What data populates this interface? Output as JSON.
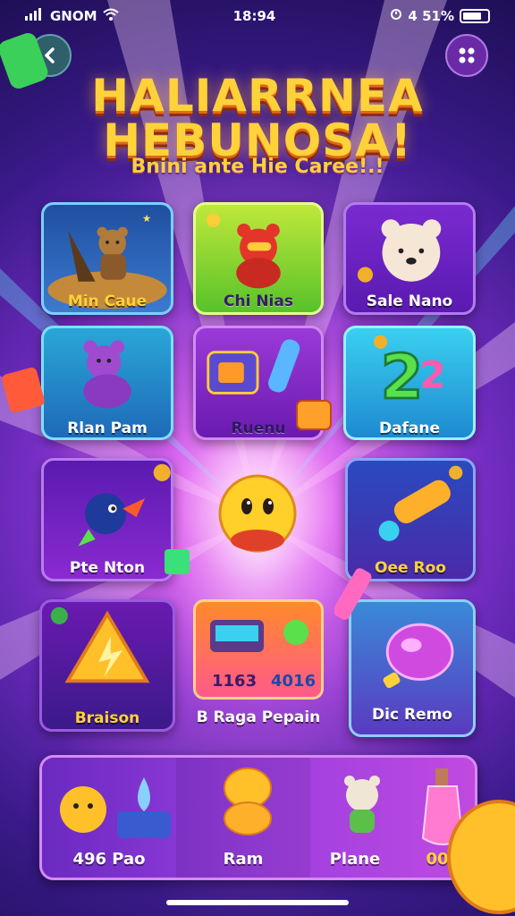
{
  "status_bar": {
    "carrier": "GNOM",
    "time": "18:94",
    "battery_text": "4 51%"
  },
  "header": {
    "title_line1": "HALIARRNEA",
    "title_line2": "HEBUNOSA!",
    "subtitle": "Bnini ante Hie Caree!.!"
  },
  "icons": {
    "back": "chevron-left-icon",
    "menu": "grid-dots-icon",
    "wifi": "wifi-icon",
    "battery": "battery-icon",
    "signal": "signal-icon"
  },
  "games": [
    {
      "label": "Min Caue"
    },
    {
      "label": "Chi Nias"
    },
    {
      "label": "Sale Nano"
    },
    {
      "label": "Rlan Pam"
    },
    {
      "label": "Ruenu"
    },
    {
      "label": "Dafane"
    },
    {
      "label": "Pte Nton"
    },
    {
      "label": "Oee Roo"
    },
    {
      "label": "Braison"
    },
    {
      "label": "B Raga Pepain"
    },
    {
      "label": "Dic Remo"
    }
  ],
  "score_card": {
    "left_value": "1163",
    "right_value": "4016"
  },
  "bottom_panel": {
    "items": [
      {
        "label": "496 Pao"
      },
      {
        "label": "Ram"
      },
      {
        "label": "Plane"
      },
      {
        "label": "00"
      }
    ]
  },
  "colors": {
    "accent_gold": "#ffd23a",
    "brand_purple": "#7a2fc9",
    "back_button": "#2f5f6a",
    "menu_button": "#6a2aa8"
  }
}
